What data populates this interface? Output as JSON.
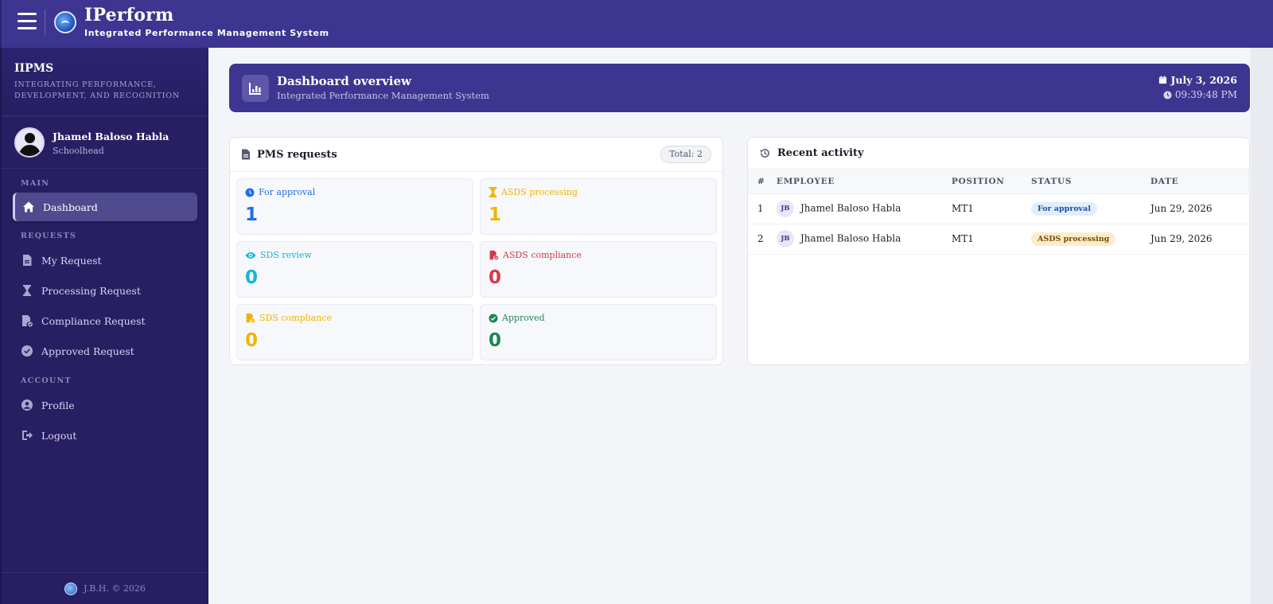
{
  "app": {
    "title": "IPerform",
    "subtitle": "Integrated Performance Management System"
  },
  "sidebar": {
    "title": "IIPMS",
    "tagline": "INTEGRATING PERFORMANCE, DEVELOPMENT, AND RECOGNITION",
    "user": {
      "name": "Jhamel Baloso Habla",
      "role": "Schoolhead"
    },
    "sections": {
      "main": "MAIN",
      "requests": "REQUESTS",
      "account": "ACCOUNT"
    },
    "items": {
      "dashboard": "Dashboard",
      "my_request": "My Request",
      "processing_request": "Processing Request",
      "compliance_request": "Compliance Request",
      "approved_request": "Approved Request",
      "profile": "Profile",
      "logout": "Logout"
    },
    "footer": "J.B.H. © 2026"
  },
  "hero": {
    "title": "Dashboard overview",
    "subtitle": "Integrated Performance Management System",
    "date": "July 3, 2026",
    "time": "09:39:48 PM"
  },
  "pms": {
    "title": "PMS requests",
    "total": "Total: 2",
    "stats": [
      {
        "label": "For approval",
        "value": "1",
        "color": "#1f6fe5",
        "icon": "clock-icon"
      },
      {
        "label": "ASDS processing",
        "value": "1",
        "color": "#f0b400",
        "icon": "hourglass-icon"
      },
      {
        "label": "SDS review",
        "value": "0",
        "color": "#17b4d9",
        "icon": "eye-icon"
      },
      {
        "label": "ASDS compliance",
        "value": "0",
        "color": "#d63a46",
        "icon": "file-check-icon"
      },
      {
        "label": "SDS compliance",
        "value": "0",
        "color": "#f0b400",
        "icon": "file-check-icon"
      },
      {
        "label": "Approved",
        "value": "0",
        "color": "#1e8554",
        "icon": "check-circle-icon"
      }
    ]
  },
  "activity": {
    "title": "Recent activity",
    "columns": [
      "#",
      "EMPLOYEE",
      "POSITION",
      "STATUS",
      "DATE"
    ],
    "rows": [
      {
        "num": "1",
        "initials": "JB",
        "employee": "Jhamel Baloso Habla",
        "position": "MT1",
        "status": "For approval",
        "status_bg": "#e3eefc",
        "status_fg": "#1f4f9c",
        "date": "Jun 29, 2026"
      },
      {
        "num": "2",
        "initials": "JB",
        "employee": "Jhamel Baloso Habla",
        "position": "MT1",
        "status": "ASDS processing",
        "status_bg": "#fdeccb",
        "status_fg": "#7a4d00",
        "date": "Jun 29, 2026"
      }
    ]
  }
}
